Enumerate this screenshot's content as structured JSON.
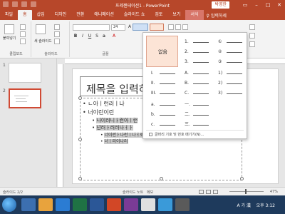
{
  "titlebar": {
    "app_title": "프레젠테이션1 - PowerPoint",
    "user": "박영한"
  },
  "tabs": [
    {
      "label": "파일"
    },
    {
      "label": "홈",
      "active": true
    },
    {
      "label": "삽입"
    },
    {
      "label": "디자인"
    },
    {
      "label": "전환"
    },
    {
      "label": "애니메이션"
    },
    {
      "label": "슬라이드 쇼"
    },
    {
      "label": "검토"
    },
    {
      "label": "보기"
    },
    {
      "label": "서식",
      "contextual": true
    }
  ],
  "tell_me": "입력하세",
  "ribbon": {
    "paste_label": "붙여넣기",
    "new_slide_label": "새 슬라이드",
    "font_size": "24",
    "groups": [
      "클립보드",
      "슬라이드",
      "글꼴"
    ]
  },
  "thumbnails": [
    {
      "num": "1"
    },
    {
      "num": "2"
    }
  ],
  "slide": {
    "title": "제목을 입력하십",
    "bullets": [
      {
        "level": 1,
        "text": "ㄴ아ㅣ런러ㅣ나"
      },
      {
        "level": 1,
        "text": "너이런이런"
      },
      {
        "level": 2,
        "text": "나이러니ㅏ런아ㅣ런",
        "highlight": true
      },
      {
        "level": 2,
        "text": "넌러ㅏ러러나ㅓㅏ",
        "highlight": true
      },
      {
        "level": 3,
        "text": "너이런ㅏ나런ㅣ나ㅓ로",
        "highlight": true
      },
      {
        "level": 3,
        "text": "너ㅣ러이나러",
        "highlight": true
      }
    ]
  },
  "dropdown": {
    "none_label": "없음",
    "cells": [
      {
        "marks": [
          "1.",
          "2.",
          "3."
        ]
      },
      {
        "marks": [
          "①",
          "②",
          "③"
        ]
      },
      {
        "marks": [
          "I.",
          "II.",
          "III."
        ]
      },
      {
        "marks": [
          "A.",
          "B.",
          "C."
        ]
      },
      {
        "marks": [
          "1)",
          "2)",
          "3)"
        ]
      },
      {
        "marks": [
          "a.",
          "b.",
          "c."
        ]
      },
      {
        "marks": [
          "一.",
          "二.",
          "三."
        ]
      }
    ],
    "footer": "글머리 기호 및 번호 매기기(N)..."
  },
  "statusbar": {
    "slide_count": "슬라이드 2/2",
    "notes": "슬라이드 노트",
    "comments": "메모",
    "zoom": "47%"
  },
  "taskbar": {
    "tray": "A 가 漢",
    "time": "오후 3:12"
  },
  "colors": {
    "accent": "#b7472a",
    "selection": "#fce4d6",
    "taskbar": "#1e3a5c"
  }
}
